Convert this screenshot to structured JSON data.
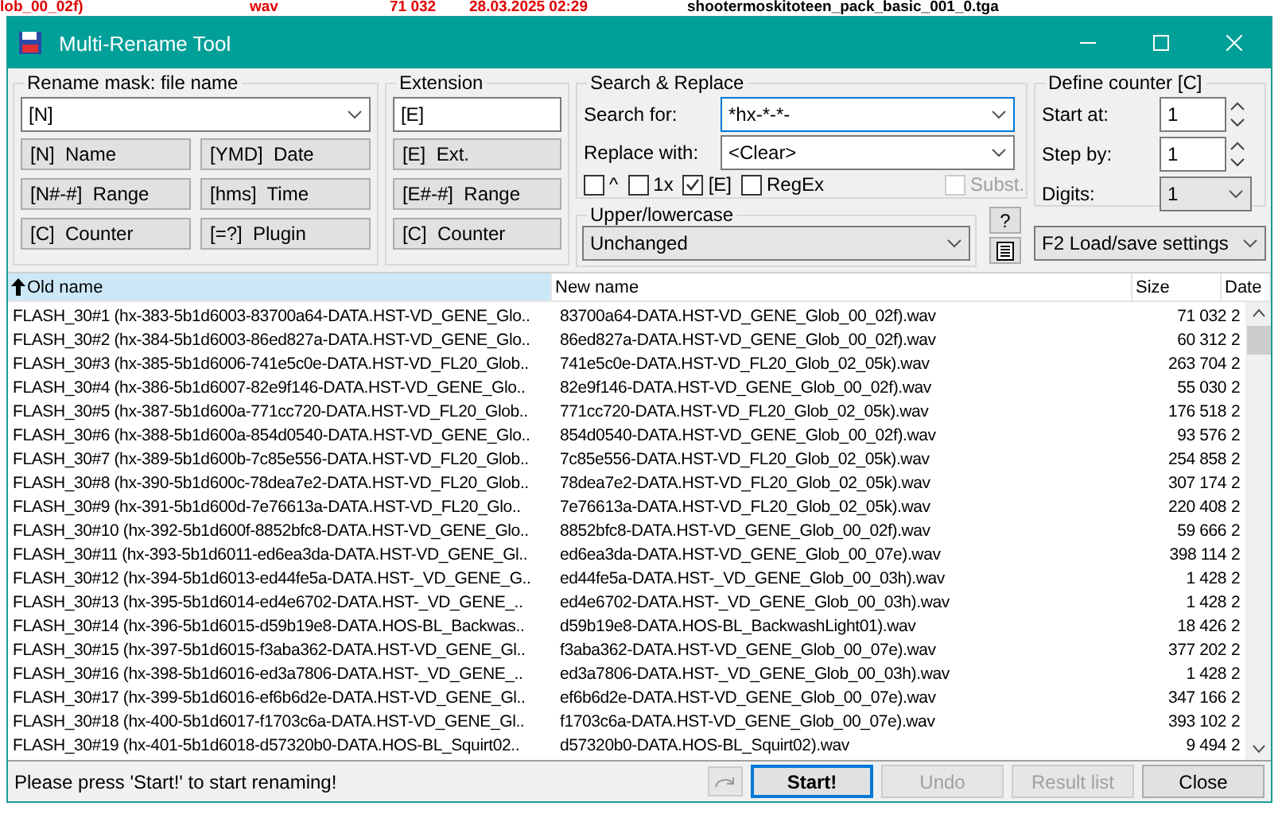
{
  "background_window": {
    "texts": [
      {
        "text": "lob_00_02f)",
        "color": "#e00000"
      },
      {
        "text": "wav",
        "color": "#e00000"
      },
      {
        "text": "71 032",
        "color": "#e00000"
      },
      {
        "text": "28.03.2025 02:29",
        "color": "#e00000"
      },
      {
        "text": "shootermoskitoteen_pack_basic_001_0.tga",
        "color": "#000000"
      }
    ]
  },
  "window": {
    "title": "Multi-Rename Tool"
  },
  "rename_mask": {
    "title": "Rename mask: file name",
    "value": "[N]",
    "buttons": [
      {
        "code": "[N]",
        "label": "Name"
      },
      {
        "code": "[YMD]",
        "label": "Date"
      },
      {
        "code": "[N#-#]",
        "label": "Range"
      },
      {
        "code": "[hms]",
        "label": "Time"
      },
      {
        "code": "[C]",
        "label": "Counter"
      },
      {
        "code": "[=?]",
        "label": "Plugin"
      }
    ]
  },
  "extension": {
    "title": "Extension",
    "value": "[E]",
    "buttons": [
      {
        "code": "[E]",
        "label": "Ext."
      },
      {
        "code": "[E#-#]",
        "label": "Range"
      },
      {
        "code": "[C]",
        "label": "Counter"
      }
    ]
  },
  "search_replace": {
    "title": "Search & Replace",
    "search_label": "Search for:",
    "search_value": "*hx-*-*-",
    "replace_label": "Replace with:",
    "replace_value": "<Clear>",
    "options": [
      {
        "label": "^",
        "checked": false,
        "disabled": false
      },
      {
        "label": "1x",
        "checked": false,
        "disabled": false
      },
      {
        "label": "[E]",
        "checked": true,
        "disabled": false
      },
      {
        "label": "RegEx",
        "checked": false,
        "disabled": false
      },
      {
        "label": "Subst.",
        "checked": false,
        "disabled": true
      }
    ]
  },
  "case": {
    "title": "Upper/lowercase",
    "value": "Unchanged"
  },
  "help_button": "?",
  "counter": {
    "title": "Define counter [C]",
    "fields": [
      {
        "label": "Start at:",
        "value": "1",
        "kind": "spin"
      },
      {
        "label": "Step by:",
        "value": "1",
        "kind": "spin"
      },
      {
        "label": "Digits:",
        "value": "1",
        "kind": "combo"
      }
    ]
  },
  "settings": {
    "value": "F2 Load/save settings"
  },
  "table": {
    "columns": [
      {
        "label": "Old name",
        "sorted": true
      },
      {
        "label": "New name",
        "sorted": false
      },
      {
        "label": "Size",
        "sorted": false
      },
      {
        "label": "Date",
        "sorted": false
      }
    ],
    "rows": [
      {
        "old": "FLASH_30#1 (hx-383-5b1d6003-83700a64-DATA.HST-VD_GENE_Glo..",
        "new": "83700a64-DATA.HST-VD_GENE_Glob_00_02f).wav",
        "size": "71 032",
        "date": "2"
      },
      {
        "old": "FLASH_30#2 (hx-384-5b1d6003-86ed827a-DATA.HST-VD_GENE_Glo..",
        "new": "86ed827a-DATA.HST-VD_GENE_Glob_00_02f).wav",
        "size": "60 312",
        "date": "2"
      },
      {
        "old": "FLASH_30#3 (hx-385-5b1d6006-741e5c0e-DATA.HST-VD_FL20_Glob..",
        "new": "741e5c0e-DATA.HST-VD_FL20_Glob_02_05k).wav",
        "size": "263 704",
        "date": "2"
      },
      {
        "old": "FLASH_30#4 (hx-386-5b1d6007-82e9f146-DATA.HST-VD_GENE_Glo..",
        "new": "82e9f146-DATA.HST-VD_GENE_Glob_00_02f).wav",
        "size": "55 030",
        "date": "2"
      },
      {
        "old": "FLASH_30#5 (hx-387-5b1d600a-771cc720-DATA.HST-VD_FL20_Glob..",
        "new": "771cc720-DATA.HST-VD_FL20_Glob_02_05k).wav",
        "size": "176 518",
        "date": "2"
      },
      {
        "old": "FLASH_30#6 (hx-388-5b1d600a-854d0540-DATA.HST-VD_GENE_Glo..",
        "new": "854d0540-DATA.HST-VD_GENE_Glob_00_02f).wav",
        "size": "93 576",
        "date": "2"
      },
      {
        "old": "FLASH_30#7 (hx-389-5b1d600b-7c85e556-DATA.HST-VD_FL20_Glob..",
        "new": "7c85e556-DATA.HST-VD_FL20_Glob_02_05k).wav",
        "size": "254 858",
        "date": "2"
      },
      {
        "old": "FLASH_30#8 (hx-390-5b1d600c-78dea7e2-DATA.HST-VD_FL20_Glob..",
        "new": "78dea7e2-DATA.HST-VD_FL20_Glob_02_05k).wav",
        "size": "307 174",
        "date": "2"
      },
      {
        "old": "FLASH_30#9 (hx-391-5b1d600d-7e76613a-DATA.HST-VD_FL20_Glo..",
        "new": "7e76613a-DATA.HST-VD_FL20_Glob_02_05k).wav",
        "size": "220 408",
        "date": "2"
      },
      {
        "old": "FLASH_30#10 (hx-392-5b1d600f-8852bfc8-DATA.HST-VD_GENE_Glo..",
        "new": "8852bfc8-DATA.HST-VD_GENE_Glob_00_02f).wav",
        "size": "59 666",
        "date": "2"
      },
      {
        "old": "FLASH_30#11 (hx-393-5b1d6011-ed6ea3da-DATA.HST-VD_GENE_Gl..",
        "new": "ed6ea3da-DATA.HST-VD_GENE_Glob_00_07e).wav",
        "size": "398 114",
        "date": "2"
      },
      {
        "old": "FLASH_30#12 (hx-394-5b1d6013-ed44fe5a-DATA.HST-_VD_GENE_G..",
        "new": "ed44fe5a-DATA.HST-_VD_GENE_Glob_00_03h).wav",
        "size": "1 428",
        "date": "2"
      },
      {
        "old": "FLASH_30#13 (hx-395-5b1d6014-ed4e6702-DATA.HST-_VD_GENE_..",
        "new": "ed4e6702-DATA.HST-_VD_GENE_Glob_00_03h).wav",
        "size": "1 428",
        "date": "2"
      },
      {
        "old": "FLASH_30#14 (hx-396-5b1d6015-d59b19e8-DATA.HOS-BL_Backwas..",
        "new": "d59b19e8-DATA.HOS-BL_BackwashLight01).wav",
        "size": "18 426",
        "date": "2"
      },
      {
        "old": "FLASH_30#15 (hx-397-5b1d6015-f3aba362-DATA.HST-VD_GENE_Gl..",
        "new": "f3aba362-DATA.HST-VD_GENE_Glob_00_07e).wav",
        "size": "377 202",
        "date": "2"
      },
      {
        "old": "FLASH_30#16 (hx-398-5b1d6016-ed3a7806-DATA.HST-_VD_GENE_..",
        "new": "ed3a7806-DATA.HST-_VD_GENE_Glob_00_03h).wav",
        "size": "1 428",
        "date": "2"
      },
      {
        "old": "FLASH_30#17 (hx-399-5b1d6016-ef6b6d2e-DATA.HST-VD_GENE_Gl..",
        "new": "ef6b6d2e-DATA.HST-VD_GENE_Glob_00_07e).wav",
        "size": "347 166",
        "date": "2"
      },
      {
        "old": "FLASH_30#18 (hx-400-5b1d6017-f1703c6a-DATA.HST-VD_GENE_Gl..",
        "new": "f1703c6a-DATA.HST-VD_GENE_Glob_00_07e).wav",
        "size": "393 102",
        "date": "2"
      },
      {
        "old": "FLASH_30#19 (hx-401-5b1d6018-d57320b0-DATA.HOS-BL_Squirt02..",
        "new": "d57320b0-DATA.HOS-BL_Squirt02).wav",
        "size": "9 494",
        "date": "2"
      }
    ]
  },
  "status": "Please press 'Start!' to start renaming!",
  "buttons": [
    {
      "label": "Start!",
      "disabled": false,
      "default": true
    },
    {
      "label": "Undo",
      "disabled": true,
      "default": false
    },
    {
      "label": "Result list",
      "disabled": true,
      "default": false
    },
    {
      "label": "Close",
      "disabled": false,
      "default": false
    }
  ]
}
